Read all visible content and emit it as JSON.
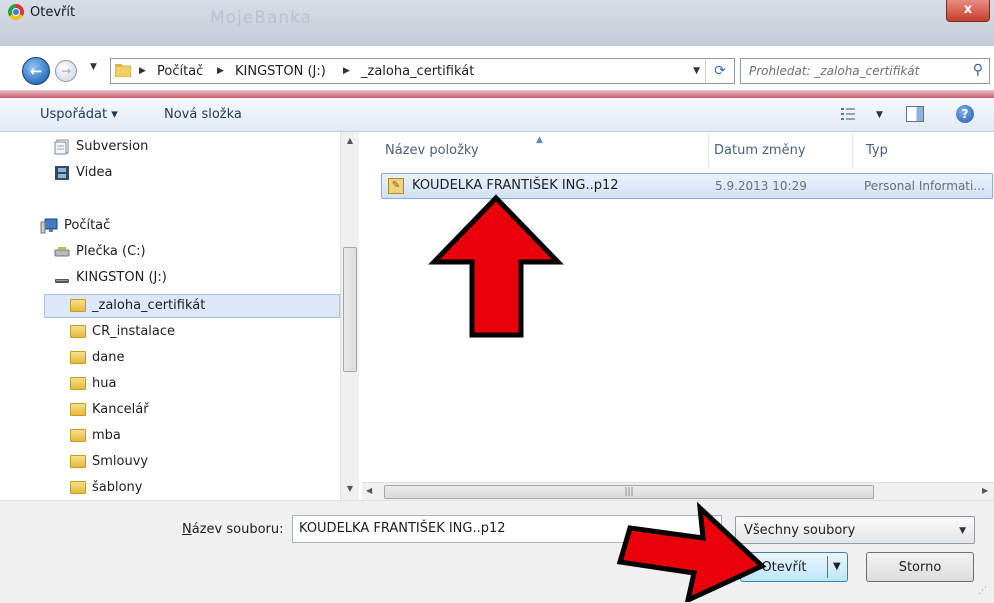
{
  "window": {
    "title": "Otevřít",
    "ghost_title": "MojeBanka",
    "close_glyph": "x"
  },
  "address": {
    "breadcrumbs": [
      "Počítač",
      "KINGSTON (J:)",
      "_zaloha_certifikát"
    ],
    "search_placeholder": "Prohledat: _zaloha_certifikát"
  },
  "toolbar": {
    "organize_label": "Uspořádat ▾",
    "new_folder_label": "Nová složka"
  },
  "nav_pane": {
    "items": [
      {
        "label": "Subversion",
        "icon": "document-stack-icon"
      },
      {
        "label": "Videa",
        "icon": "film-icon"
      },
      {
        "label": "Počítač",
        "icon": "computer-icon"
      },
      {
        "label": "Plečka (C:)",
        "icon": "drive-icon"
      },
      {
        "label": "KINGSTON (J:)",
        "icon": "usb-drive-icon"
      },
      {
        "label": "_zaloha_certifikát",
        "icon": "folder-icon",
        "selected": true
      },
      {
        "label": "CR_instalace",
        "icon": "folder-icon"
      },
      {
        "label": "dane",
        "icon": "folder-icon"
      },
      {
        "label": "hua",
        "icon": "folder-icon"
      },
      {
        "label": "Kancelář",
        "icon": "folder-icon"
      },
      {
        "label": "mba",
        "icon": "folder-icon"
      },
      {
        "label": "Smlouvy",
        "icon": "folder-icon"
      },
      {
        "label": "šablony",
        "icon": "folder-icon"
      }
    ]
  },
  "file_list": {
    "columns": [
      "Název položky",
      "Datum změny",
      "Typ"
    ],
    "rows": [
      {
        "name": "KOUDELKA FRANTIŠEK ING..p12",
        "date": "5.9.2013 10:29",
        "type": "Personal Informati...",
        "selected": true
      }
    ]
  },
  "footer": {
    "filename_label_underlined": "N",
    "filename_label_rest": "ázev souboru:",
    "filename_value": "KOUDELKA FRANTIŠEK ING..p12",
    "filter_value": "Všechny soubory",
    "open_label": "Otevřít",
    "cancel_label": "Storno"
  },
  "colors": {
    "annotation_arrow_fill": "#e8000a",
    "selection_blue": "#cfe1f7"
  }
}
